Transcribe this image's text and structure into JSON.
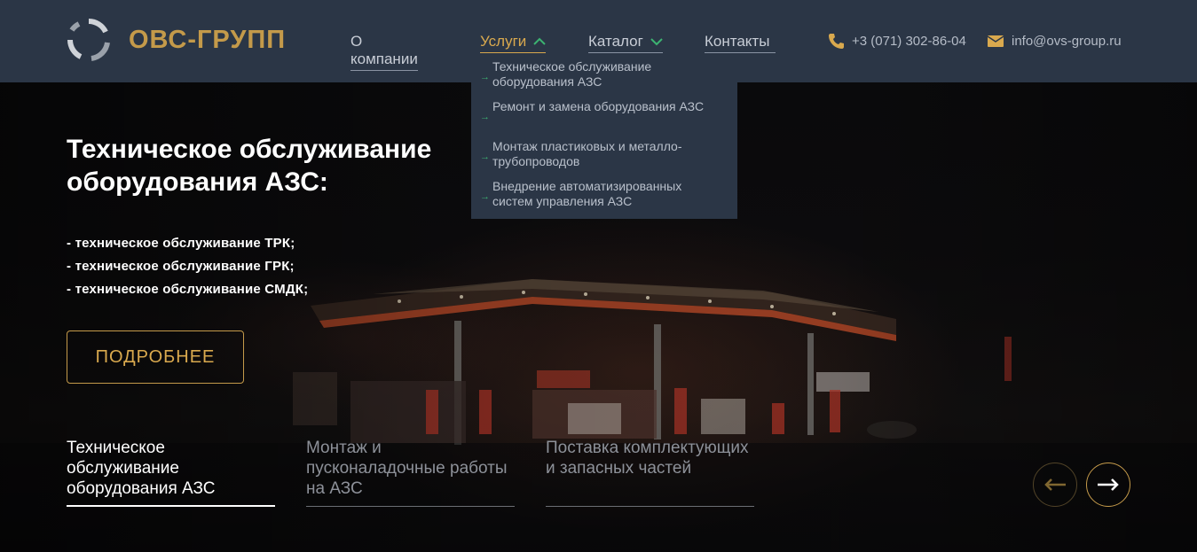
{
  "header": {
    "logo_text": "ОВС-ГРУПП",
    "nav": {
      "about": "О компании",
      "services": "Услуги",
      "catalog": "Каталог",
      "contacts": "Контакты"
    },
    "phone": "+3 (071) 302-86-04",
    "email": "info@ovs-group.ru"
  },
  "dropdown": {
    "items": [
      "Техническое обслуживание оборудования АЗС",
      "Ремонт и замена оборудования АЗС",
      "Монтаж пластиковых и металло-трубопроводов",
      "Внедрение автоматизированных систем управления АЗС"
    ]
  },
  "hero": {
    "title": "Техническое обслуживание оборудования АЗС:",
    "list": [
      "- техническое обслуживание ТРК;",
      "- техническое обслуживание ГРК;",
      "- техническое обслуживание СМДК;"
    ],
    "button_label": "ПОДРОБНЕЕ"
  },
  "slider": {
    "tabs": [
      "Техническое обслуживание оборудования АЗС",
      "Монтаж и пусконаладочные работы на АЗС",
      "Поставка комплектующих и запасных частей"
    ],
    "active_index": 0
  },
  "icons": {
    "phone": "phone-icon",
    "email": "mail-icon",
    "prev": "arrow-left-icon",
    "next": "arrow-right-icon"
  },
  "colors": {
    "accent": "#c49a4a",
    "header_bg": "#2b3646",
    "link_arrow": "#3cb371"
  }
}
